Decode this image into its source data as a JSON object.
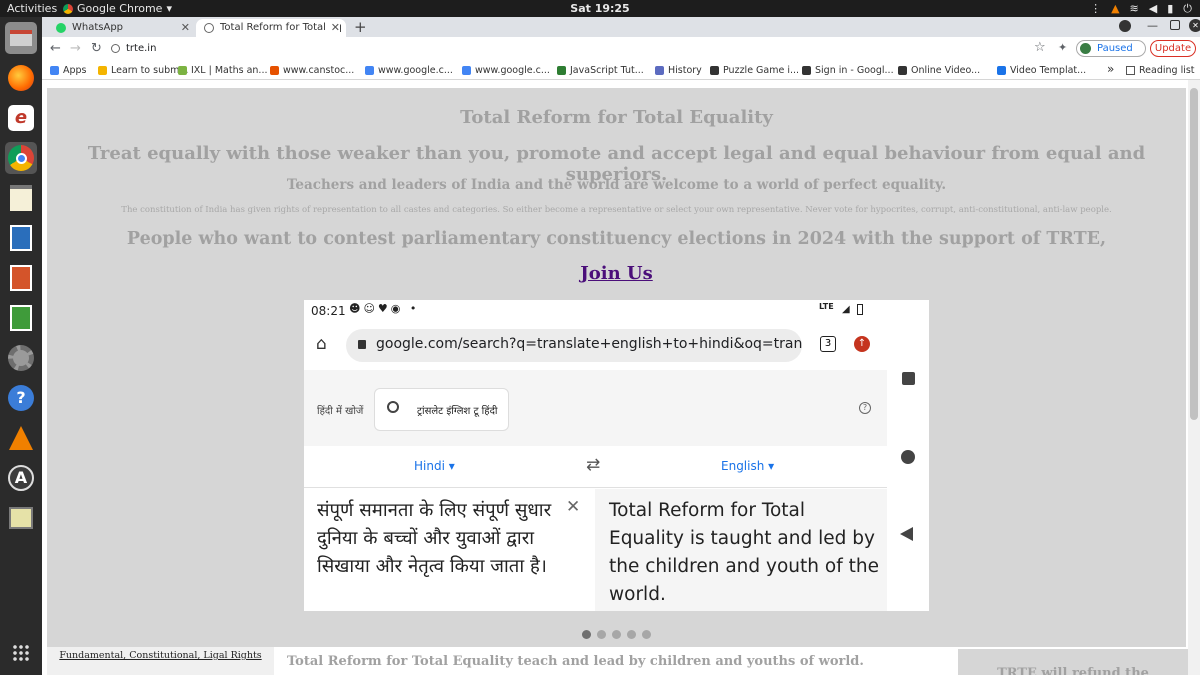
{
  "os": {
    "activities": "Activities",
    "app_name": "Google Chrome",
    "clock": "Sat 19:25"
  },
  "tabs": [
    {
      "label": "WhatsApp",
      "favicon_color": "#25d366"
    },
    {
      "label": "Total Reform for Total Eq",
      "favicon_color": "#666666"
    }
  ],
  "toolbar": {
    "url": "trte.in",
    "paused_label": "Paused",
    "update_label": "Update"
  },
  "bookmarks": {
    "items": [
      {
        "label": "Apps",
        "color": "#4285f4"
      },
      {
        "label": "Learn to subm...",
        "color": "#f4b400"
      },
      {
        "label": "IXL | Maths an...",
        "color": "#7cb342"
      },
      {
        "label": "www.canstoc...",
        "color": "#e65100"
      },
      {
        "label": "www.google.c...",
        "color": "#4285f4"
      },
      {
        "label": "www.google.c...",
        "color": "#4285f4"
      },
      {
        "label": "JavaScript Tut...",
        "color": "#2e7d32"
      },
      {
        "label": "History",
        "color": "#5c6bc0"
      },
      {
        "label": "Puzzle Game i...",
        "color": "#333333"
      },
      {
        "label": "Sign in - Googl...",
        "color": "#333333"
      },
      {
        "label": "Online Video...",
        "color": "#333333"
      },
      {
        "label": "Video Templat...",
        "color": "#1a73e8"
      }
    ],
    "more": "»",
    "reading_list": "Reading list"
  },
  "page": {
    "title": "Total Reform for Total Equality",
    "tagline": "Treat equally with those weaker than you, promote and accept legal and equal behaviour from equal and superiors.",
    "welcome": "Teachers and leaders of India and the world are welcome to a world of perfect equality.",
    "note": "The constitution of India has given rights of representation to all castes and categories. So either become a representative or select your own representative. Never vote for hypocrites, corrupt, anti-constitutional, anti-law people.",
    "contest": "People who want to contest parliamentary constituency elections in 2024 with the support of TRTE,",
    "join_label": "Join Us",
    "sidebar_link": "Fundamental, Constitutional, Ligal Rights",
    "bottom_text": "Total Reform for Total Equality teach and lead by children and youths of world.",
    "right_box_text": "TRTE will refund the"
  },
  "phone": {
    "time": "08:21",
    "network": "LTE",
    "url": "google.com/search?q=translate+english+to+hindi&oq=trans&aqs=cl",
    "tab_count": "3",
    "search_label": "हिंदी में खोजें",
    "search_query": "ट्रांसलेट इंग्लिश टू हिंदी",
    "lang_from": "Hindi",
    "lang_to": "English",
    "source_text": "संपूर्ण समानता के लिए संपूर्ण सुधार दुनिया के बच्चों और युवाओं द्वारा सिखाया और नेतृत्व किया जाता है।",
    "target_text": "Total Reform for Total Equality is taught and led by the children and youth of the world."
  },
  "carousel": {
    "slides": 5,
    "active_index": 0
  }
}
